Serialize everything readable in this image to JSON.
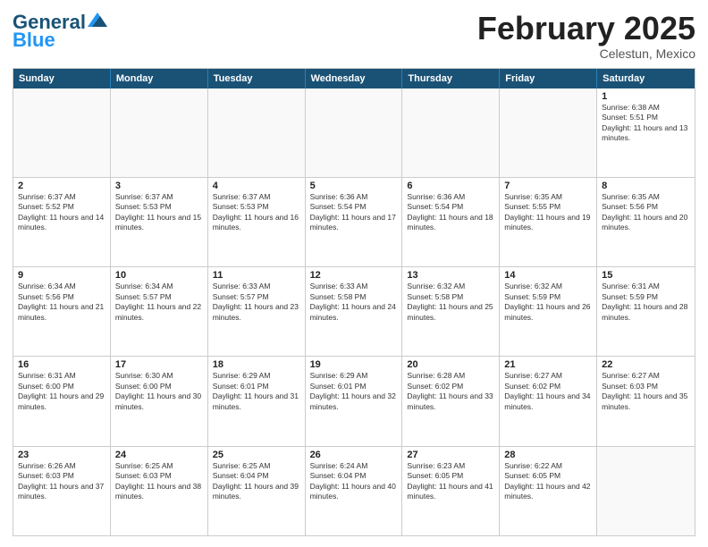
{
  "header": {
    "logo_line1": "General",
    "logo_line2": "Blue",
    "month_title": "February 2025",
    "location": "Celestun, Mexico"
  },
  "days": [
    "Sunday",
    "Monday",
    "Tuesday",
    "Wednesday",
    "Thursday",
    "Friday",
    "Saturday"
  ],
  "weeks": [
    [
      {
        "day": "",
        "empty": true
      },
      {
        "day": "",
        "empty": true
      },
      {
        "day": "",
        "empty": true
      },
      {
        "day": "",
        "empty": true
      },
      {
        "day": "",
        "empty": true
      },
      {
        "day": "",
        "empty": true
      },
      {
        "day": "1",
        "sunrise": "Sunrise: 6:38 AM",
        "sunset": "Sunset: 5:51 PM",
        "daylight": "Daylight: 11 hours and 13 minutes."
      }
    ],
    [
      {
        "day": "2",
        "sunrise": "Sunrise: 6:37 AM",
        "sunset": "Sunset: 5:52 PM",
        "daylight": "Daylight: 11 hours and 14 minutes."
      },
      {
        "day": "3",
        "sunrise": "Sunrise: 6:37 AM",
        "sunset": "Sunset: 5:53 PM",
        "daylight": "Daylight: 11 hours and 15 minutes."
      },
      {
        "day": "4",
        "sunrise": "Sunrise: 6:37 AM",
        "sunset": "Sunset: 5:53 PM",
        "daylight": "Daylight: 11 hours and 16 minutes."
      },
      {
        "day": "5",
        "sunrise": "Sunrise: 6:36 AM",
        "sunset": "Sunset: 5:54 PM",
        "daylight": "Daylight: 11 hours and 17 minutes."
      },
      {
        "day": "6",
        "sunrise": "Sunrise: 6:36 AM",
        "sunset": "Sunset: 5:54 PM",
        "daylight": "Daylight: 11 hours and 18 minutes."
      },
      {
        "day": "7",
        "sunrise": "Sunrise: 6:35 AM",
        "sunset": "Sunset: 5:55 PM",
        "daylight": "Daylight: 11 hours and 19 minutes."
      },
      {
        "day": "8",
        "sunrise": "Sunrise: 6:35 AM",
        "sunset": "Sunset: 5:56 PM",
        "daylight": "Daylight: 11 hours and 20 minutes."
      }
    ],
    [
      {
        "day": "9",
        "sunrise": "Sunrise: 6:34 AM",
        "sunset": "Sunset: 5:56 PM",
        "daylight": "Daylight: 11 hours and 21 minutes."
      },
      {
        "day": "10",
        "sunrise": "Sunrise: 6:34 AM",
        "sunset": "Sunset: 5:57 PM",
        "daylight": "Daylight: 11 hours and 22 minutes."
      },
      {
        "day": "11",
        "sunrise": "Sunrise: 6:33 AM",
        "sunset": "Sunset: 5:57 PM",
        "daylight": "Daylight: 11 hours and 23 minutes."
      },
      {
        "day": "12",
        "sunrise": "Sunrise: 6:33 AM",
        "sunset": "Sunset: 5:58 PM",
        "daylight": "Daylight: 11 hours and 24 minutes."
      },
      {
        "day": "13",
        "sunrise": "Sunrise: 6:32 AM",
        "sunset": "Sunset: 5:58 PM",
        "daylight": "Daylight: 11 hours and 25 minutes."
      },
      {
        "day": "14",
        "sunrise": "Sunrise: 6:32 AM",
        "sunset": "Sunset: 5:59 PM",
        "daylight": "Daylight: 11 hours and 26 minutes."
      },
      {
        "day": "15",
        "sunrise": "Sunrise: 6:31 AM",
        "sunset": "Sunset: 5:59 PM",
        "daylight": "Daylight: 11 hours and 28 minutes."
      }
    ],
    [
      {
        "day": "16",
        "sunrise": "Sunrise: 6:31 AM",
        "sunset": "Sunset: 6:00 PM",
        "daylight": "Daylight: 11 hours and 29 minutes."
      },
      {
        "day": "17",
        "sunrise": "Sunrise: 6:30 AM",
        "sunset": "Sunset: 6:00 PM",
        "daylight": "Daylight: 11 hours and 30 minutes."
      },
      {
        "day": "18",
        "sunrise": "Sunrise: 6:29 AM",
        "sunset": "Sunset: 6:01 PM",
        "daylight": "Daylight: 11 hours and 31 minutes."
      },
      {
        "day": "19",
        "sunrise": "Sunrise: 6:29 AM",
        "sunset": "Sunset: 6:01 PM",
        "daylight": "Daylight: 11 hours and 32 minutes."
      },
      {
        "day": "20",
        "sunrise": "Sunrise: 6:28 AM",
        "sunset": "Sunset: 6:02 PM",
        "daylight": "Daylight: 11 hours and 33 minutes."
      },
      {
        "day": "21",
        "sunrise": "Sunrise: 6:27 AM",
        "sunset": "Sunset: 6:02 PM",
        "daylight": "Daylight: 11 hours and 34 minutes."
      },
      {
        "day": "22",
        "sunrise": "Sunrise: 6:27 AM",
        "sunset": "Sunset: 6:03 PM",
        "daylight": "Daylight: 11 hours and 35 minutes."
      }
    ],
    [
      {
        "day": "23",
        "sunrise": "Sunrise: 6:26 AM",
        "sunset": "Sunset: 6:03 PM",
        "daylight": "Daylight: 11 hours and 37 minutes."
      },
      {
        "day": "24",
        "sunrise": "Sunrise: 6:25 AM",
        "sunset": "Sunset: 6:03 PM",
        "daylight": "Daylight: 11 hours and 38 minutes."
      },
      {
        "day": "25",
        "sunrise": "Sunrise: 6:25 AM",
        "sunset": "Sunset: 6:04 PM",
        "daylight": "Daylight: 11 hours and 39 minutes."
      },
      {
        "day": "26",
        "sunrise": "Sunrise: 6:24 AM",
        "sunset": "Sunset: 6:04 PM",
        "daylight": "Daylight: 11 hours and 40 minutes."
      },
      {
        "day": "27",
        "sunrise": "Sunrise: 6:23 AM",
        "sunset": "Sunset: 6:05 PM",
        "daylight": "Daylight: 11 hours and 41 minutes."
      },
      {
        "day": "28",
        "sunrise": "Sunrise: 6:22 AM",
        "sunset": "Sunset: 6:05 PM",
        "daylight": "Daylight: 11 hours and 42 minutes."
      },
      {
        "day": "",
        "empty": true
      }
    ]
  ]
}
